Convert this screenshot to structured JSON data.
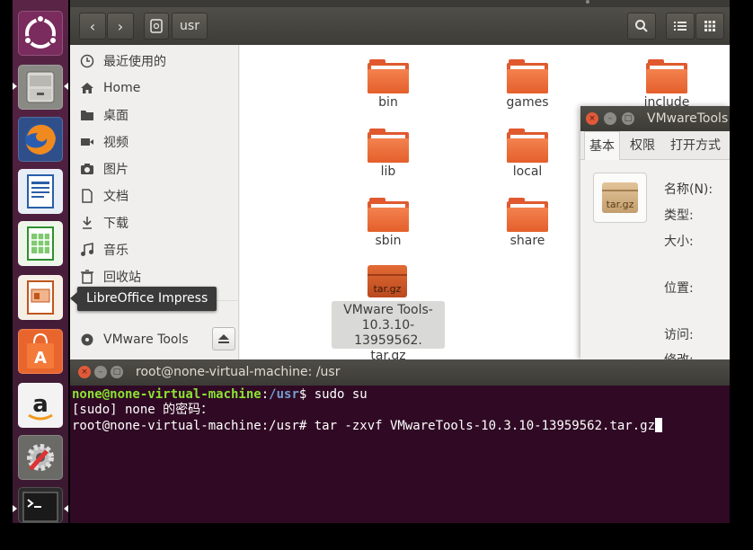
{
  "launcher": {
    "items": [
      {
        "name": "dash-home",
        "icon": "ubuntu-logo-icon"
      },
      {
        "name": "files",
        "icon": "file-cabinet-icon"
      },
      {
        "name": "firefox",
        "icon": "firefox-icon"
      },
      {
        "name": "libreoffice-writer",
        "icon": "writer-icon"
      },
      {
        "name": "libreoffice-calc",
        "icon": "calc-icon"
      },
      {
        "name": "libreoffice-impress",
        "icon": "impress-icon"
      },
      {
        "name": "ubuntu-software",
        "icon": "shopping-bag-icon"
      },
      {
        "name": "amazon",
        "icon": "amazon-icon"
      },
      {
        "name": "system-settings",
        "icon": "settings-icon"
      },
      {
        "name": "terminal",
        "icon": "terminal-icon"
      }
    ],
    "tooltip": "LibreOffice Impress"
  },
  "files": {
    "path_label": "usr",
    "sidebar": [
      {
        "label": "最近使用的",
        "icon": "clock-icon"
      },
      {
        "label": "Home",
        "icon": "home-icon"
      },
      {
        "label": "桌面",
        "icon": "folder-icon"
      },
      {
        "label": "视频",
        "icon": "video-icon"
      },
      {
        "label": "图片",
        "icon": "camera-icon"
      },
      {
        "label": "文档",
        "icon": "document-icon"
      },
      {
        "label": "下载",
        "icon": "download-icon"
      },
      {
        "label": "音乐",
        "icon": "music-icon"
      },
      {
        "label": "回收站",
        "icon": "trash-icon"
      },
      {
        "label": "VMware Tools",
        "icon": "disc-icon"
      }
    ],
    "items": [
      {
        "label": "bin"
      },
      {
        "label": "games"
      },
      {
        "label": "include"
      },
      {
        "label": "lib"
      },
      {
        "label": "local"
      },
      {
        "label": "sbin"
      },
      {
        "label": "share"
      },
      {
        "label_lines": [
          "VMware Tools-",
          "10.3.10-13959562.",
          "tar.gz"
        ],
        "icon_text": "tar.gz"
      }
    ]
  },
  "properties": {
    "title": "VMwareTools",
    "tabs": [
      "基本",
      "权限",
      "打开方式"
    ],
    "icon_text": "tar.gz",
    "fields": [
      "名称(N):",
      "类型:",
      "大小:",
      "位置:",
      "访问:",
      "修改:"
    ]
  },
  "terminal": {
    "title": "root@none-virtual-machine: /usr",
    "line1_user": "none@none-virtual-machine",
    "line1_sep": ":",
    "line1_path": "/usr",
    "line1_cmd": "$ sudo su",
    "line2": "[sudo] none 的密码：",
    "line3": "root@none-virtual-machine:/usr# tar -zxvf VMwareTools-10.3.10-13959562.tar.gz"
  }
}
